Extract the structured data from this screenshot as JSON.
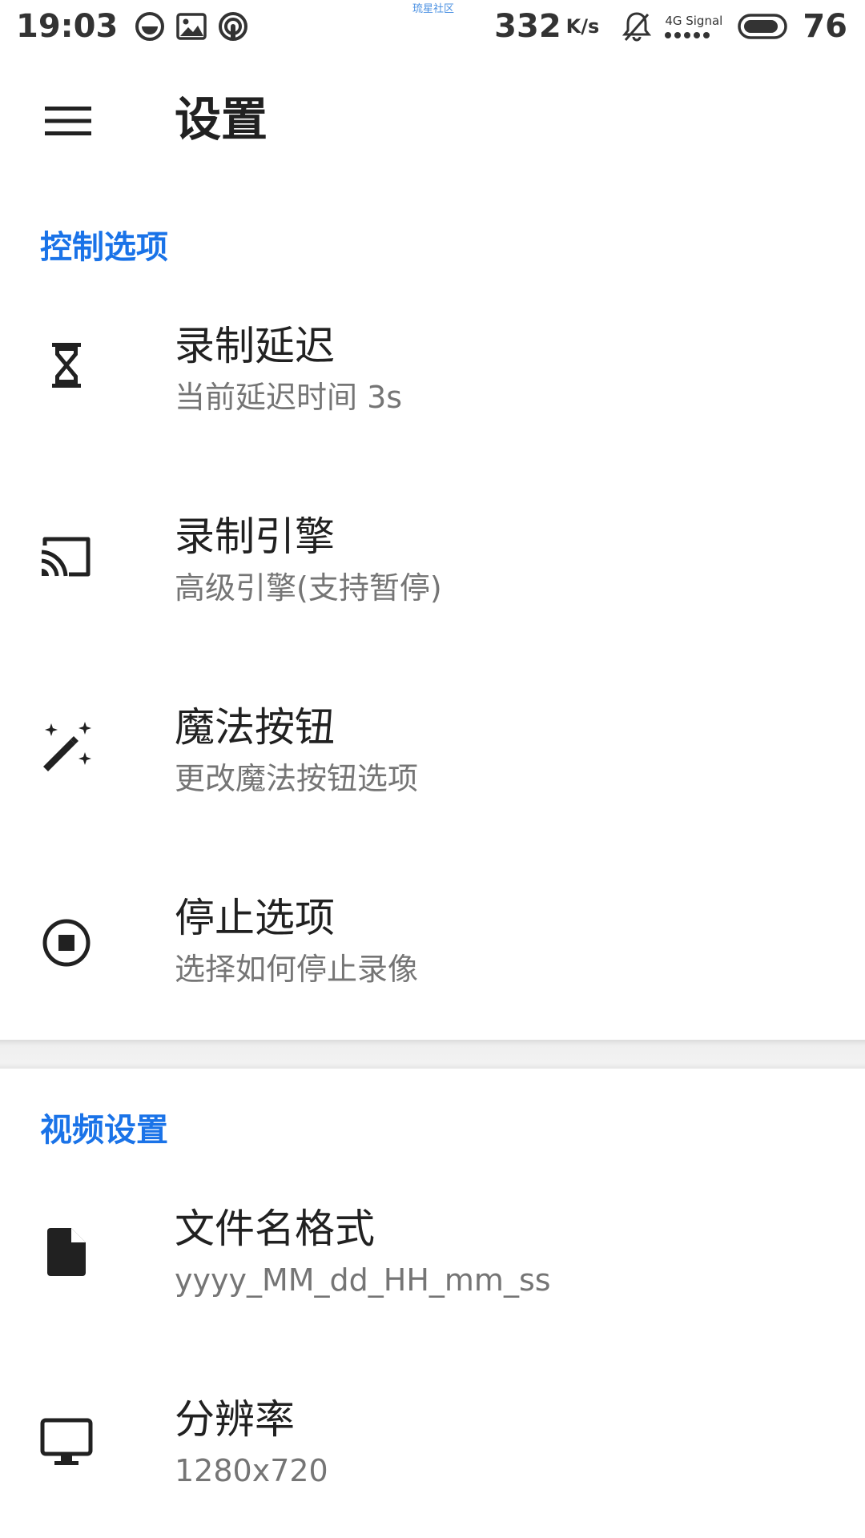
{
  "status_bar": {
    "time": "19:03",
    "network_speed": "332",
    "network_speed_unit": "K/s",
    "signal_label": "4G Signal",
    "battery": "76",
    "watermark": "琉星社区"
  },
  "toolbar": {
    "title": "设置",
    "menu_icon": "hamburger-menu-icon"
  },
  "sections": {
    "control": {
      "header": "控制选项",
      "items": [
        {
          "title": "录制延迟",
          "summary": "当前延迟时间 3s",
          "icon": "hourglass-icon"
        },
        {
          "title": "录制引擎",
          "summary": "高级引擎(支持暂停)",
          "icon": "cast-icon"
        },
        {
          "title": "魔法按钮",
          "summary": "更改魔法按钮选项",
          "icon": "magic-wand-icon"
        },
        {
          "title": "停止选项",
          "summary": "选择如何停止录像",
          "icon": "stop-circle-icon"
        }
      ]
    },
    "video": {
      "header": "视频设置",
      "items": [
        {
          "title": "文件名格式",
          "summary": "yyyy_MM_dd_HH_mm_ss",
          "icon": "file-icon"
        },
        {
          "title": "分辨率",
          "summary": "1280x720",
          "icon": "monitor-icon"
        }
      ]
    }
  },
  "colors": {
    "accent": "#1a73e8",
    "title_text": "#212121",
    "summary_text": "#757575",
    "background": "#ffffff"
  }
}
